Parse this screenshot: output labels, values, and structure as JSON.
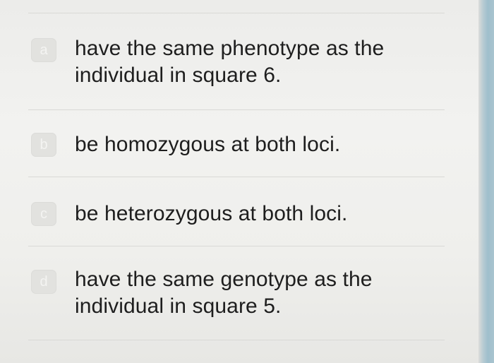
{
  "options": [
    {
      "letter": "a",
      "text": "have the same phenotype as the individual in square 6."
    },
    {
      "letter": "b",
      "text": "be homozygous at both loci."
    },
    {
      "letter": "c",
      "text": "be heterozygous at both loci."
    },
    {
      "letter": "d",
      "text": "have the same genotype as the individual in square 5."
    }
  ],
  "colors": {
    "background": "#efefec",
    "text": "#1e1e1e",
    "badge": "#e2e2df",
    "divider": "#d9d9d6"
  }
}
